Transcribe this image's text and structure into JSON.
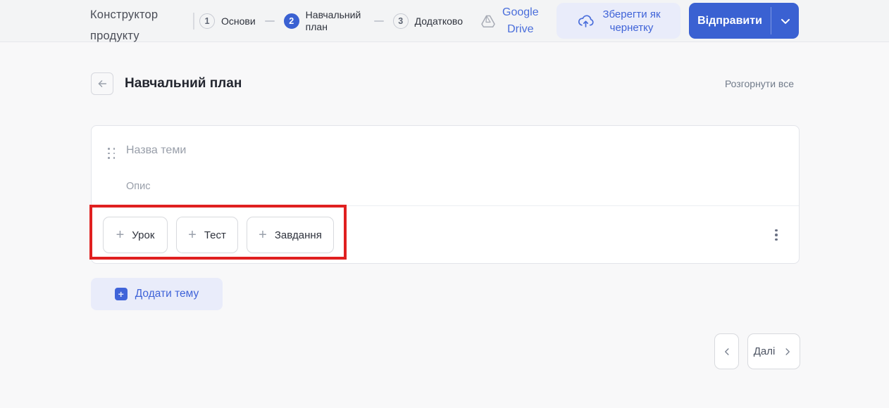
{
  "header": {
    "app_title_line1": "Конструктор",
    "app_title_line2": "продукту",
    "steps": [
      {
        "number": "1",
        "label": "Основи",
        "state": "inactive"
      },
      {
        "number": "2",
        "label": "Навчальний план",
        "state": "active"
      },
      {
        "number": "3",
        "label": "Додатково",
        "state": "inactive"
      }
    ],
    "google_drive": {
      "line1": "Google",
      "line2": "Drive"
    },
    "save_draft": {
      "line1": "Зберегти як",
      "line2": "чернетку"
    },
    "submit_label": "Відправити"
  },
  "page": {
    "title": "Навчальний план",
    "expand_all_label": "Розгорнути все"
  },
  "topic_card": {
    "name_placeholder": "Назва теми",
    "description_placeholder": "Опис",
    "add_buttons": [
      {
        "label": "Урок"
      },
      {
        "label": "Тест"
      },
      {
        "label": "Завдання"
      }
    ]
  },
  "actions": {
    "add_topic_label": "Додати тему"
  },
  "pagination": {
    "next_label": "Далі"
  },
  "icons": {
    "plus": "+"
  },
  "colors": {
    "accent_blue": "#3a61d2",
    "light_blue_bg": "#e9ecfa",
    "blue_text": "#3f63d8",
    "annotation_red": "#e02020",
    "header_bg": "#f3f4f5",
    "page_bg": "#f8f8f9"
  }
}
